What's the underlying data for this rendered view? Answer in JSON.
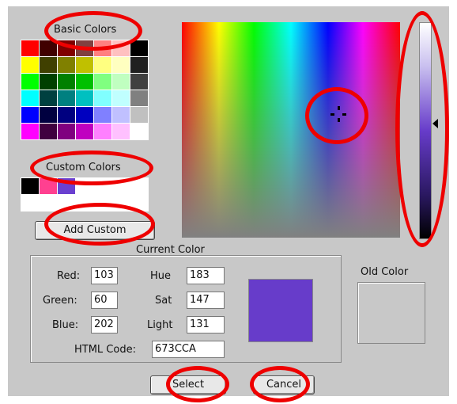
{
  "labels": {
    "basic_colors": "Basic Colors",
    "custom_colors": "Custom Colors",
    "current_color": "Current Color",
    "old_color": "Old Color"
  },
  "buttons": {
    "add_custom": "Add Custom",
    "select": "Select",
    "cancel": "Cancel"
  },
  "fields": {
    "red": {
      "label": "Red:",
      "value": "103"
    },
    "green": {
      "label": "Green:",
      "value": "60"
    },
    "blue": {
      "label": "Blue:",
      "value": "202"
    },
    "hue": {
      "label": "Hue",
      "value": "183"
    },
    "sat": {
      "label": "Sat",
      "value": "147"
    },
    "light": {
      "label": "Light",
      "value": "131"
    },
    "html_code": {
      "label": "HTML Code:",
      "value": "673CCA"
    }
  },
  "colors": {
    "current": "#673cca",
    "old": "#c8c8c8",
    "annotation": "#ee0000"
  },
  "basic_colors": [
    [
      "#ff0000",
      "#400000",
      "#800000",
      "#804040",
      "#ff8080",
      "#ffc0c0",
      "#000000"
    ],
    [
      "#ffff00",
      "#404000",
      "#808000",
      "#c0c000",
      "#ffff80",
      "#ffffc0",
      "#202020"
    ],
    [
      "#00ff00",
      "#004000",
      "#008000",
      "#00c000",
      "#80ff80",
      "#c0ffc0",
      "#404040"
    ],
    [
      "#00ffff",
      "#004040",
      "#008080",
      "#00c0c0",
      "#80ffff",
      "#c0ffff",
      "#808080"
    ],
    [
      "#0000ff",
      "#000040",
      "#000080",
      "#0000c0",
      "#8080ff",
      "#c0c0ff",
      "#c0c0c0"
    ],
    [
      "#ff00ff",
      "#400040",
      "#800080",
      "#c000c0",
      "#ff80ff",
      "#ffc0ff",
      "#ffffff"
    ]
  ],
  "custom_colors": [
    [
      "#000000",
      "#ff4090",
      "#6a40d0",
      "#ffffff",
      "#ffffff",
      "#ffffff",
      "#ffffff"
    ],
    [
      "#ffffff",
      "#ffffff",
      "#ffffff",
      "#ffffff",
      "#ffffff",
      "#ffffff",
      "#ffffff"
    ]
  ],
  "icons": {
    "crosshair": "crosshair-icon",
    "luminance_pointer": "triangle-left-icon"
  }
}
